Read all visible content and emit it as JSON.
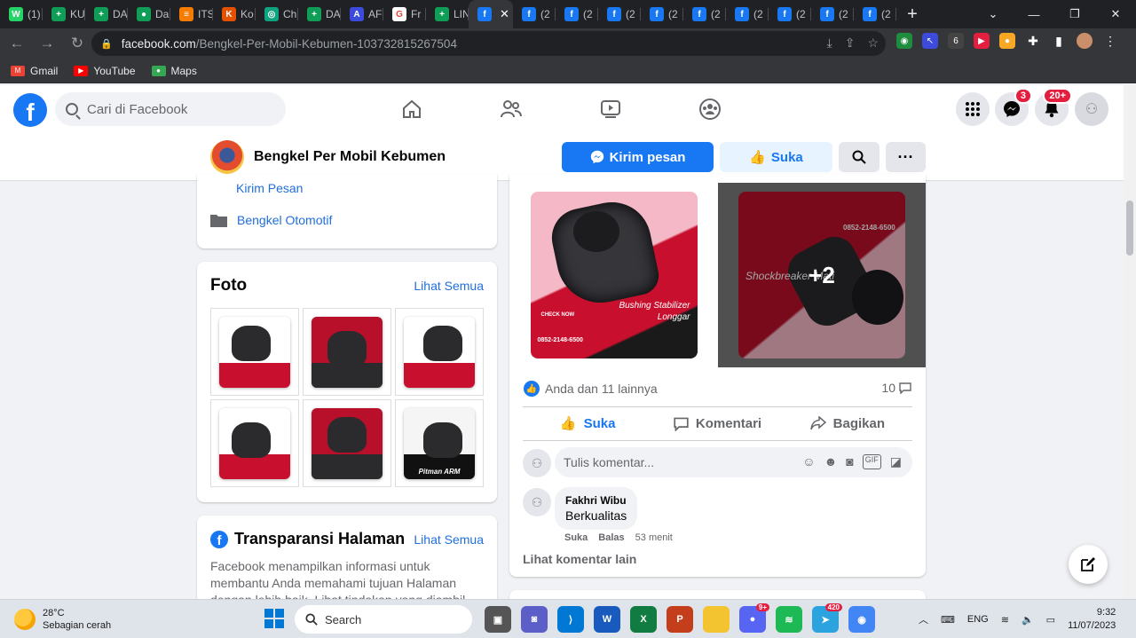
{
  "browser": {
    "tabs": [
      {
        "label": "(1)",
        "color": "#25d366",
        "glyph": "W"
      },
      {
        "label": "KU",
        "color": "#0f9d58",
        "glyph": "+"
      },
      {
        "label": "DA",
        "color": "#0f9d58",
        "glyph": "+"
      },
      {
        "label": "Da",
        "color": "#0f9d58",
        "glyph": "●"
      },
      {
        "label": "ITS",
        "color": "#f57c00",
        "glyph": "≡"
      },
      {
        "label": "Ko",
        "color": "#e65100",
        "glyph": "K"
      },
      {
        "label": "Ch",
        "color": "#10a37f",
        "glyph": "◎"
      },
      {
        "label": "DA",
        "color": "#0f9d58",
        "glyph": "+"
      },
      {
        "label": "AF",
        "color": "#3c4bdc",
        "glyph": "A"
      },
      {
        "label": "Fr",
        "color": "#ffffff",
        "glyph": "G"
      },
      {
        "label": "LIN",
        "color": "#0f9d58",
        "glyph": "+"
      },
      {
        "label": "",
        "color": "#1877f2",
        "glyph": "f",
        "active": true
      },
      {
        "label": "(2",
        "color": "#1877f2",
        "glyph": "f"
      },
      {
        "label": "(2",
        "color": "#1877f2",
        "glyph": "f"
      },
      {
        "label": "(2",
        "color": "#1877f2",
        "glyph": "f"
      },
      {
        "label": "(2",
        "color": "#1877f2",
        "glyph": "f"
      },
      {
        "label": "(2",
        "color": "#1877f2",
        "glyph": "f"
      },
      {
        "label": "(2",
        "color": "#1877f2",
        "glyph": "f"
      },
      {
        "label": "(2",
        "color": "#1877f2",
        "glyph": "f"
      },
      {
        "label": "(2",
        "color": "#1877f2",
        "glyph": "f"
      },
      {
        "label": "(2",
        "color": "#1877f2",
        "glyph": "f"
      }
    ],
    "url_host": "facebook.com",
    "url_path": "/Bengkel-Per-Mobil-Kebumen-103732815267504",
    "bookmarks": [
      {
        "label": "Gmail",
        "color": "#ea4335",
        "glyph": "M"
      },
      {
        "label": "YouTube",
        "color": "#ff0000",
        "glyph": "▶"
      },
      {
        "label": "Maps",
        "color": "#34a853",
        "glyph": "●"
      }
    ]
  },
  "fb": {
    "search_placeholder": "Cari di Facebook",
    "messenger_badge": "3",
    "notif_badge": "20+",
    "page_name": "Bengkel Per Mobil Kebumen",
    "btn_message": "Kirim pesan",
    "btn_like": "Suka",
    "intro": {
      "send_message": "Kirim Pesan",
      "category": "Bengkel Otomotif"
    },
    "photos": {
      "title": "Foto",
      "see_all": "Lihat Semua",
      "items": [
        {
          "bg": "#ffffff",
          "accent": "#c8102e",
          "text": ""
        },
        {
          "bg": "#b8102a",
          "accent": "#2b2b2e",
          "text": ""
        },
        {
          "bg": "#ffffff",
          "accent": "#c8102e",
          "text": ""
        },
        {
          "bg": "#ffffff",
          "accent": "#c8102e",
          "text": ""
        },
        {
          "bg": "#b8102a",
          "accent": "#2b2b2e",
          "text": ""
        },
        {
          "bg": "#f5f5f5",
          "accent": "#111111",
          "text": "Pitman ARM"
        }
      ]
    },
    "transparency": {
      "title": "Transparansi Halaman",
      "see_all": "Lihat Semua",
      "desc": "Facebook menampilkan informasi untuk membantu Anda memahami tujuan Halaman dengan lebih baik. Lihat tindakan yang diambil"
    },
    "post": {
      "img1_caption": "Bushing Stabilizer Longgar",
      "img1_phone": "0852-2148-6500",
      "img1_check": "CHECK NOW",
      "img2_caption": "Shockbreaker Mati",
      "img2_phone": "0852-2148-6500",
      "more_count": "+2",
      "reactions": "Anda dan 11 lainnya",
      "comment_count": "10",
      "action_like": "Suka",
      "action_comment": "Komentari",
      "action_share": "Bagikan",
      "comment_placeholder": "Tulis komentar...",
      "comment": {
        "author": "Fakhri Wibu",
        "text": "Berkualitas",
        "like": "Suka",
        "reply": "Balas",
        "time": "53 menit"
      },
      "more_comments": "Lihat komentar lain"
    }
  },
  "taskbar": {
    "temp": "28°C",
    "weather": "Sebagian cerah",
    "search": "Search",
    "lang": "ENG",
    "time": "9:32",
    "date": "11/07/2023",
    "apps": [
      {
        "name": "file-explorer-app",
        "color": "#f4c430",
        "glyph": ""
      },
      {
        "name": "discord-app",
        "color": "#5865f2",
        "glyph": "●",
        "badge": "9+"
      },
      {
        "name": "spotify-app",
        "color": "#1db954",
        "glyph": "≋"
      },
      {
        "name": "telegram-app",
        "color": "#2aa3df",
        "glyph": "➤",
        "badge": "420"
      },
      {
        "name": "chrome-app",
        "color": "#4285f4",
        "glyph": "◉"
      }
    ]
  }
}
